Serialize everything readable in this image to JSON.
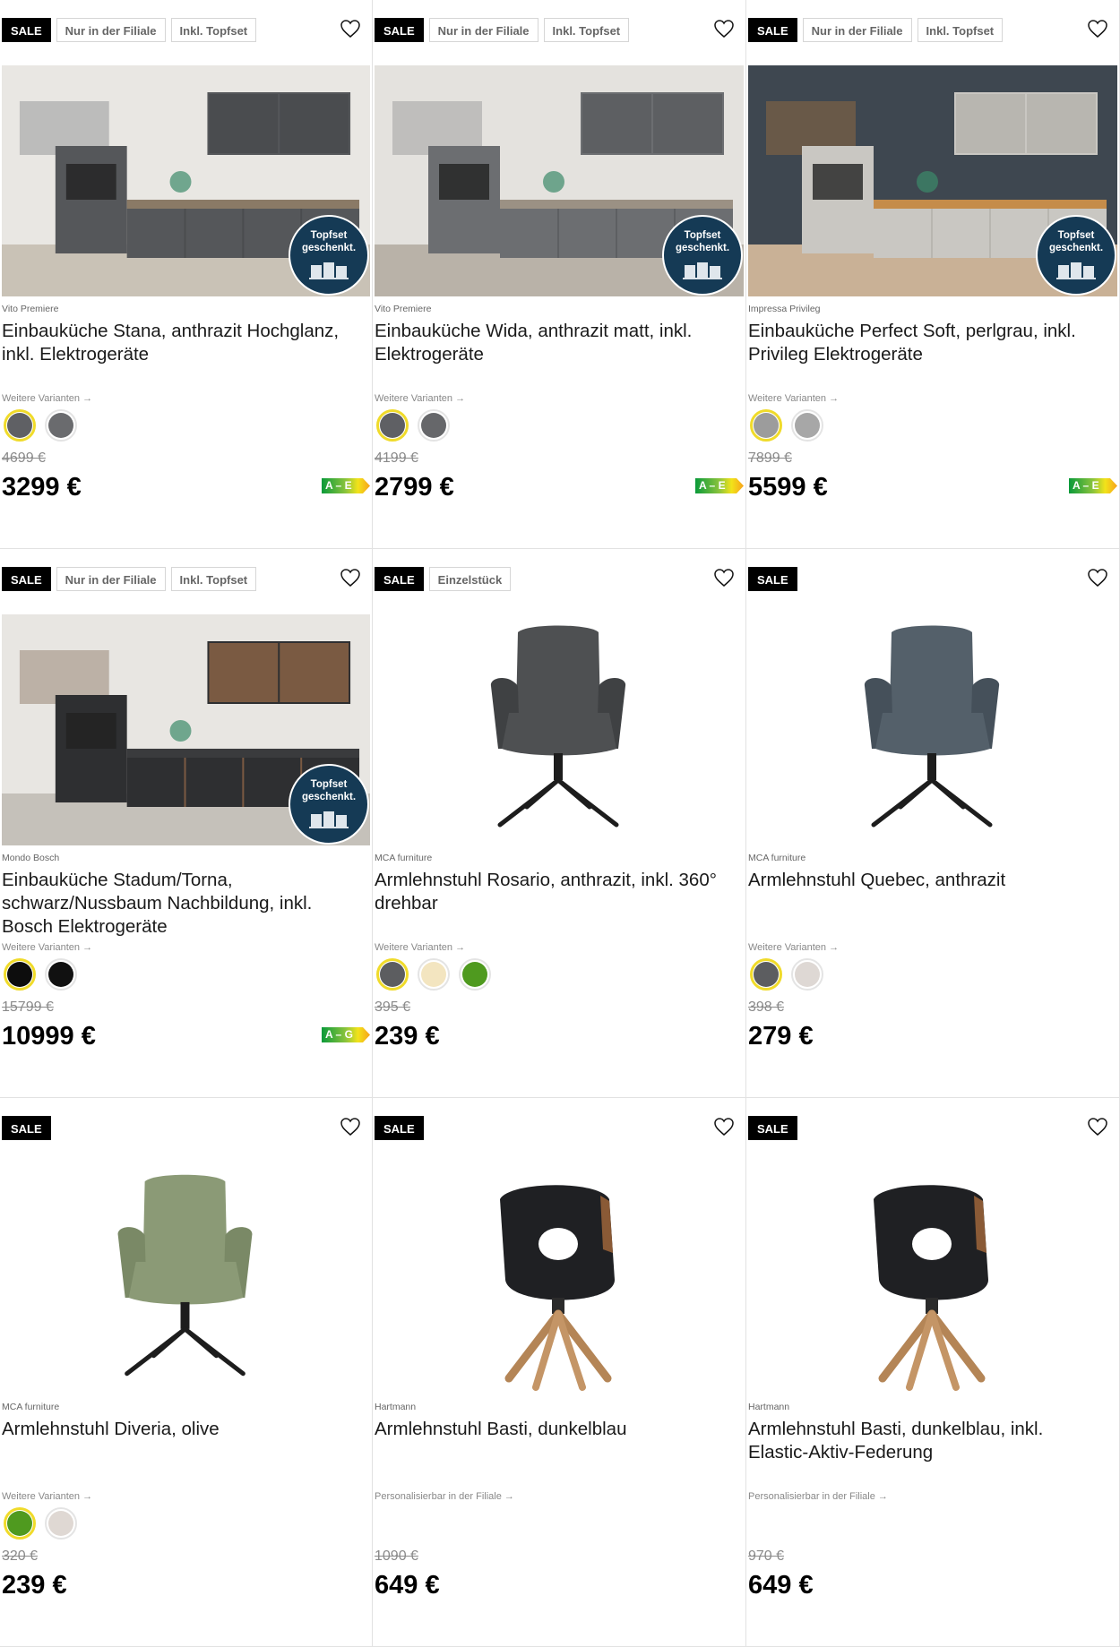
{
  "products": [
    {
      "badges": [
        "SALE",
        "Nur in der Filiale",
        "Inkl. Topfset"
      ],
      "brand": "Vito Premiere",
      "title": "Einbauküche Stana, anthrazit Hochglanz, inkl. Elektrogeräte",
      "variants_link": "Weitere Varianten →",
      "swatches": [
        "#5f6064",
        "#6a6b6e"
      ],
      "old_price": "4699 €",
      "price": "3299 €",
      "energy_label": "A – E",
      "topfset": "Topfset geschenkt.",
      "image": "kitchen-anthracite-gloss"
    },
    {
      "badges": [
        "SALE",
        "Nur in der Filiale",
        "Inkl. Topfset"
      ],
      "brand": "Vito Premiere",
      "title": "Einbauküche Wida, anthrazit matt, inkl. Elektrogeräte",
      "variants_link": "Weitere Varianten →",
      "swatches": [
        "#5f6064",
        "#66676a"
      ],
      "old_price": "4199 €",
      "price": "2799 €",
      "energy_label": "A – E",
      "topfset": "Topfset geschenkt.",
      "image": "kitchen-anthracite-matt"
    },
    {
      "badges": [
        "SALE",
        "Nur in der Filiale",
        "Inkl. Topfset"
      ],
      "brand": "Impressa Privileg",
      "title": "Einbauküche Perfect Soft, perlgrau, inkl. Privileg Elektrogeräte",
      "variants_link": "Weitere Varianten →",
      "swatches": [
        "#9c9c9c",
        "#a7a7a7"
      ],
      "old_price": "7899 €",
      "price": "5599 €",
      "energy_label": "A – E",
      "topfset": "Topfset geschenkt.",
      "image": "kitchen-pearl-grey"
    },
    {
      "badges": [
        "SALE",
        "Nur in der Filiale",
        "Inkl. Topfset"
      ],
      "brand": "Mondo Bosch",
      "title": "Einbauküche Stadum/Torna, schwarz/Nussbaum Nachbildung, inkl. Bosch Elektrogeräte",
      "variants_link": "Weitere Varianten →",
      "swatches": [
        "#0d0d0d",
        "#111111"
      ],
      "old_price": "15799 €",
      "price": "10999 €",
      "energy_label": "A – G",
      "topfset": "Topfset geschenkt.",
      "image": "kitchen-black-walnut"
    },
    {
      "badges": [
        "SALE",
        "Einzelstück"
      ],
      "brand": "MCA furniture",
      "title": "Armlehnstuhl Rosario, anthrazit, inkl. 360° drehbar",
      "variants_link": "Weitere Varianten →",
      "swatches": [
        "#5c5d60",
        "#f3e5c0",
        "#4f9a1f"
      ],
      "old_price": "395 €",
      "price": "239 €",
      "energy_label": "",
      "topfset": "",
      "image": "chair-anthracite"
    },
    {
      "badges": [
        "SALE"
      ],
      "brand": "MCA furniture",
      "title": "Armlehnstuhl Quebec, anthrazit",
      "variants_link": "Weitere Varianten →",
      "swatches": [
        "#5c5d60",
        "#ded8d4"
      ],
      "old_price": "398 €",
      "price": "279 €",
      "energy_label": "",
      "topfset": "",
      "image": "chair-quebec"
    },
    {
      "badges": [
        "SALE"
      ],
      "brand": "MCA furniture",
      "title": "Armlehnstuhl Diveria, olive",
      "variants_link": "Weitere Varianten →",
      "swatches": [
        "#4f9a1f",
        "#dfd8d3"
      ],
      "old_price": "320 €",
      "price": "239 €",
      "energy_label": "",
      "topfset": "",
      "image": "chair-olive"
    },
    {
      "badges": [
        "SALE"
      ],
      "brand": "Hartmann",
      "title": "Armlehnstuhl Basti, dunkelblau",
      "variants_link": "Personalisierbar in der Filiale →",
      "swatches": [],
      "old_price": "1090 €",
      "price": "649 €",
      "energy_label": "",
      "topfset": "",
      "image": "chair-basti"
    },
    {
      "badges": [
        "SALE"
      ],
      "brand": "Hartmann",
      "title": "Armlehnstuhl Basti, dunkelblau, inkl. Elastic-Aktiv-Federung",
      "variants_link": "Personalisierbar in der Filiale →",
      "swatches": [],
      "old_price": "970 €",
      "price": "649 €",
      "energy_label": "",
      "topfset": "",
      "image": "chair-basti"
    }
  ],
  "colors": {
    "sale_badge": "#000000",
    "selected_swatch_ring": "#f0db2a",
    "topfset_circle": "#153a55"
  }
}
